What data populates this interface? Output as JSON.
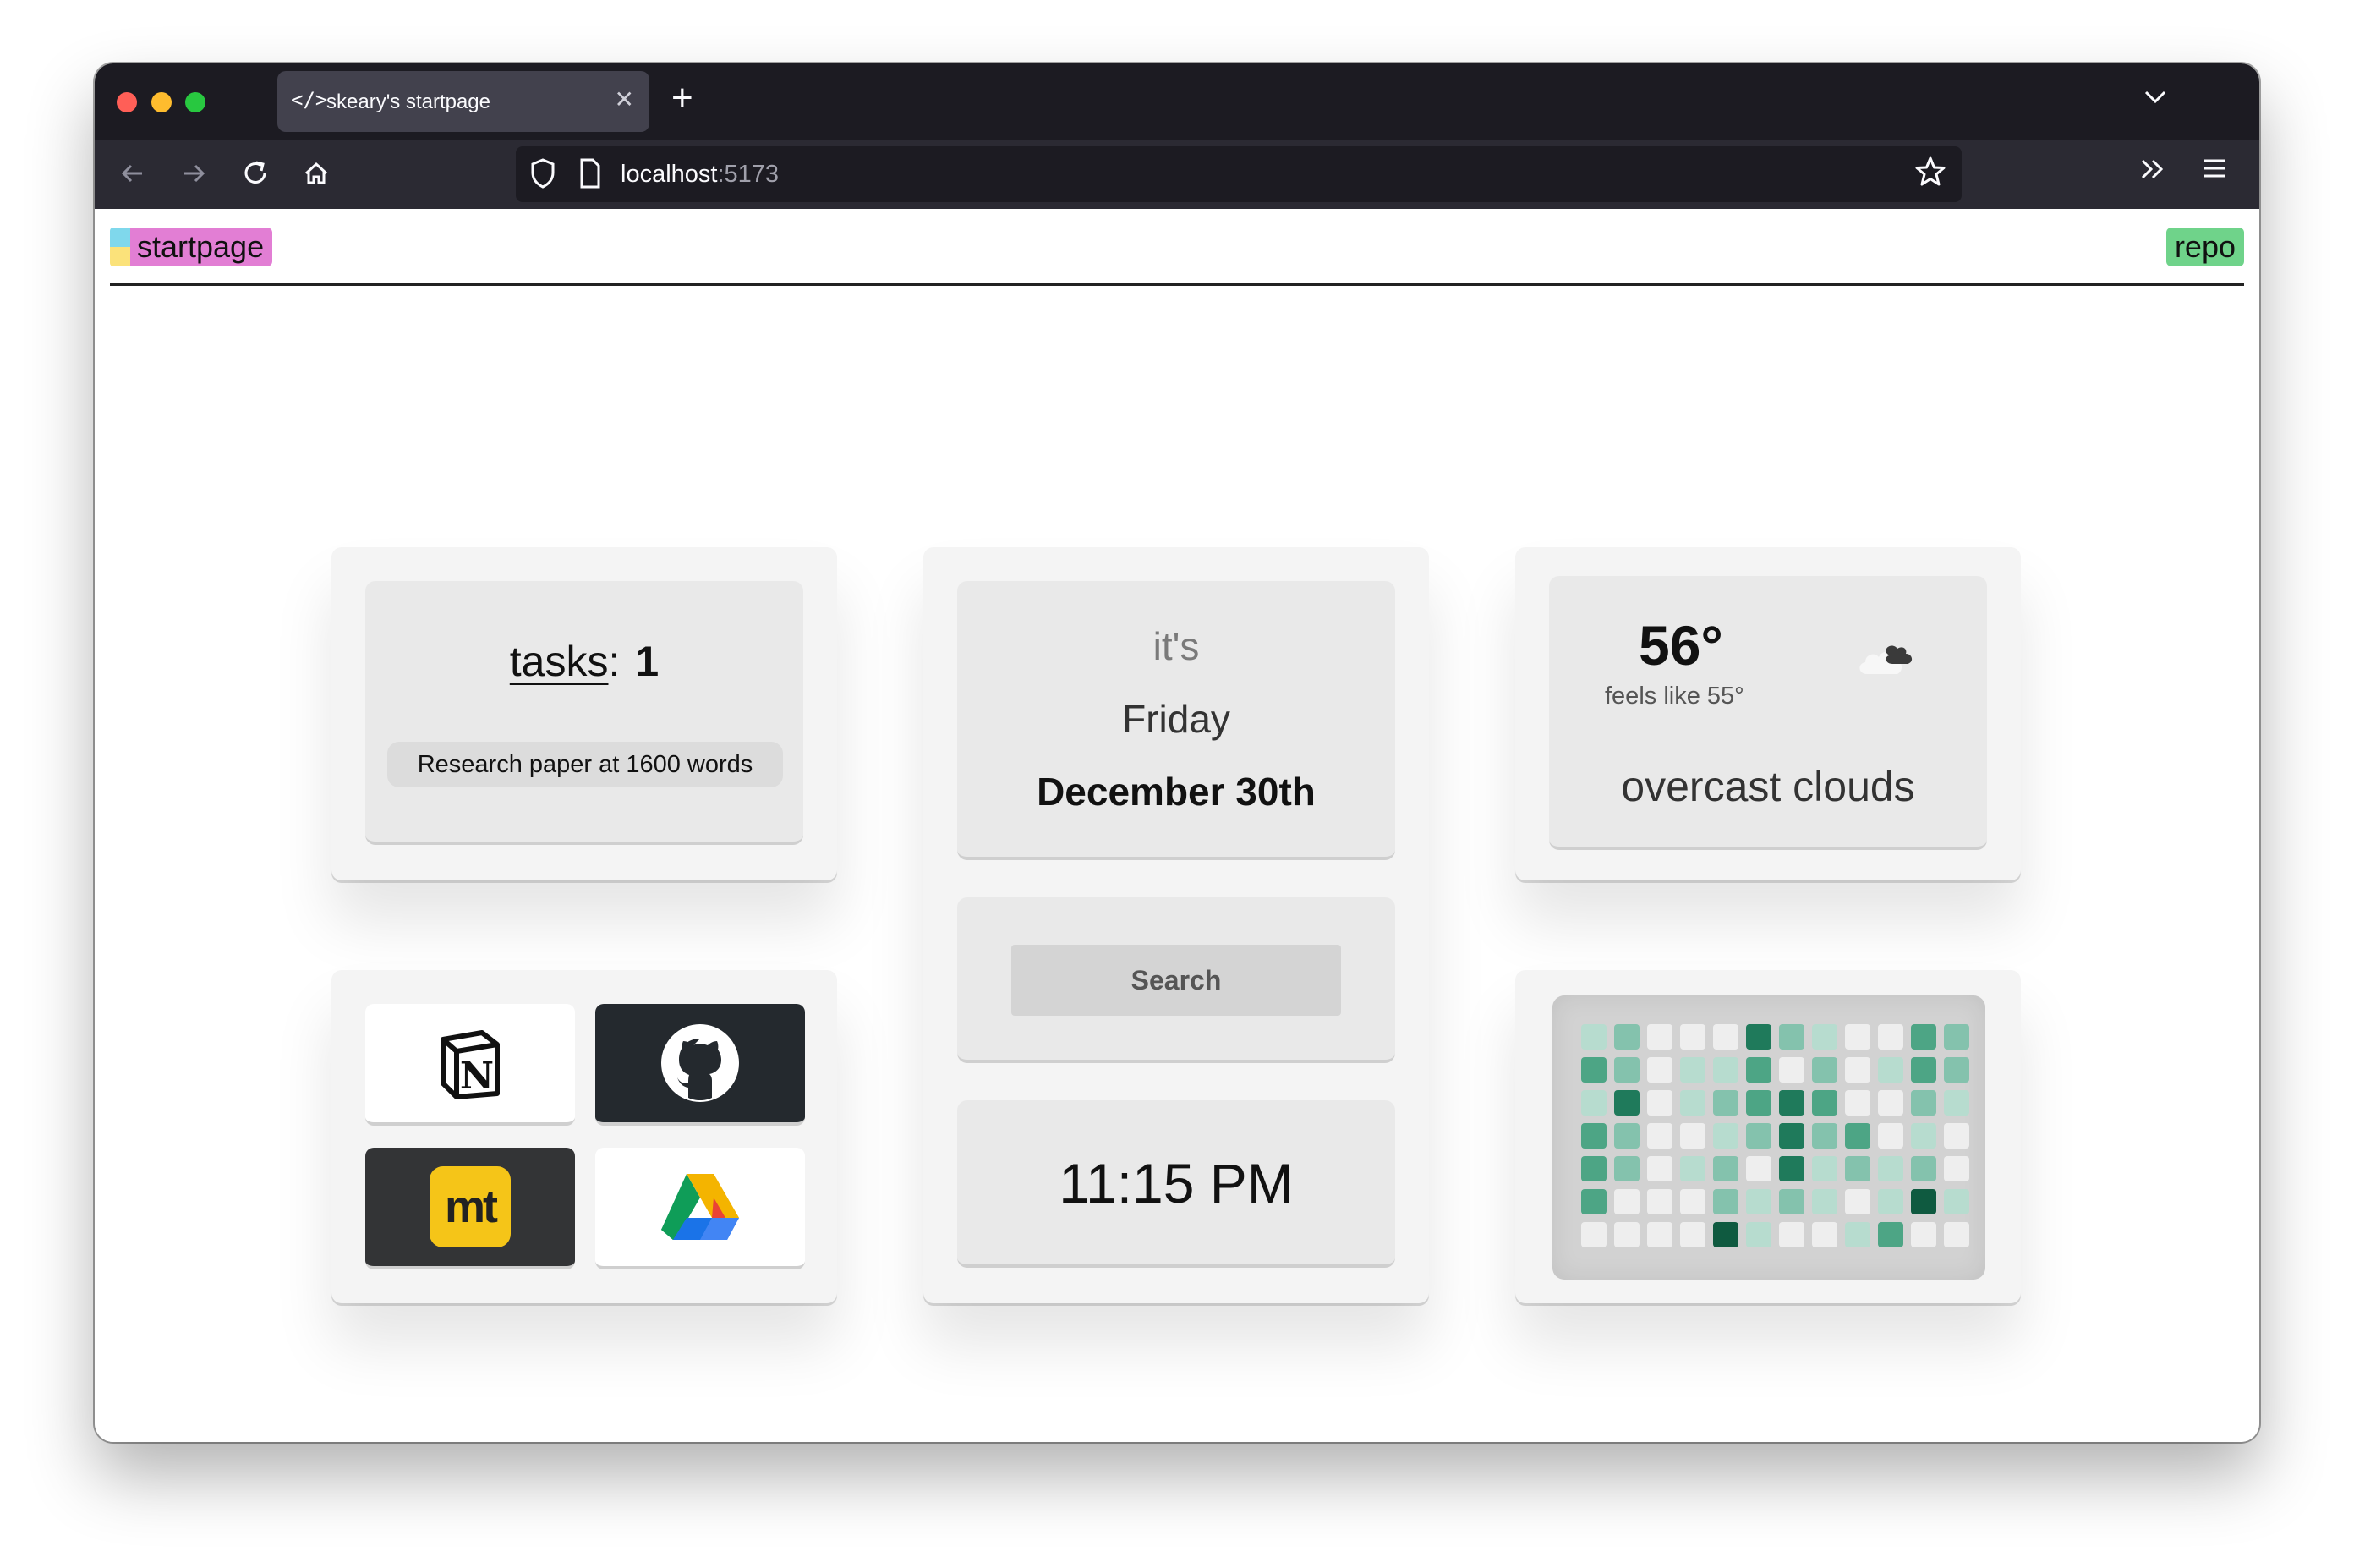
{
  "browser": {
    "tab_title": "skeary's startpage",
    "tab_icon": "</>",
    "url_host": "localhost",
    "url_port": ":5173"
  },
  "page": {
    "brand": "startpage",
    "repo": "repo"
  },
  "tasks": {
    "label": "tasks",
    "colon": ":",
    "count": "1",
    "items": [
      "Research paper at 1600 words"
    ]
  },
  "date": {
    "prefix": "it's",
    "weekday": "Friday",
    "date": "December 30th"
  },
  "search": {
    "label": "Search"
  },
  "clock": {
    "time": "11:15 PM"
  },
  "weather": {
    "temp": "56°",
    "feels": "feels like 55°",
    "condition": "overcast clouds",
    "icon": "cloud-icon"
  },
  "links": [
    {
      "name": "notion",
      "icon": "notion-icon"
    },
    {
      "name": "github",
      "icon": "github-icon"
    },
    {
      "name": "mt",
      "icon": "mt-icon",
      "text": "mt"
    },
    {
      "name": "google-drive",
      "icon": "google-drive-icon"
    }
  ],
  "heatmap": {
    "colors": [
      "#eeeeee",
      "#b7dccf",
      "#84c2ad",
      "#4da585",
      "#1f7a5b",
      "#0f5a40"
    ],
    "levels": [
      [
        1,
        2,
        0,
        0,
        0,
        4,
        2,
        1,
        0,
        0,
        3,
        2
      ],
      [
        3,
        2,
        0,
        1,
        1,
        3,
        0,
        2,
        0,
        1,
        3,
        2
      ],
      [
        1,
        4,
        0,
        1,
        2,
        3,
        4,
        3,
        0,
        0,
        2,
        1
      ],
      [
        3,
        2,
        0,
        0,
        1,
        2,
        4,
        2,
        3,
        0,
        1,
        0
      ],
      [
        3,
        2,
        0,
        1,
        2,
        0,
        4,
        1,
        2,
        1,
        2,
        0
      ],
      [
        3,
        0,
        0,
        0,
        2,
        1,
        2,
        1,
        0,
        1,
        5,
        1
      ],
      [
        0,
        0,
        0,
        0,
        5,
        1,
        0,
        0,
        1,
        3,
        0,
        0
      ]
    ]
  }
}
